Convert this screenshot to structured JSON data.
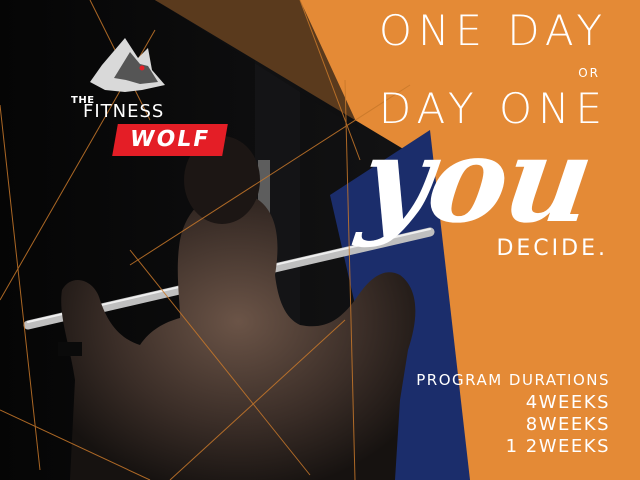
{
  "brand": {
    "logo_line_1": "THE",
    "logo_line_2": "FITNESS",
    "logo_line_3": "WOLF",
    "logo_icon": "wolf-head-icon",
    "logo_accent": "#e41e26"
  },
  "headline": {
    "line_1": "ONE DAY",
    "connector": "OR",
    "line_2": "DAY ONE",
    "emphasis": "you",
    "line_3": "DECIDE."
  },
  "program": {
    "title": "PROGRAM DURATIONS",
    "durations": [
      "4WEEKS",
      "8WEEKS",
      "1 2WEEKS"
    ]
  },
  "colors": {
    "orange_panel": "#e48a36",
    "navy_panel": "#1b2d6b",
    "text": "#ffffff",
    "background": "#0b0b0b"
  },
  "photo_subject": "shirtless man doing lat pulldown, back view"
}
